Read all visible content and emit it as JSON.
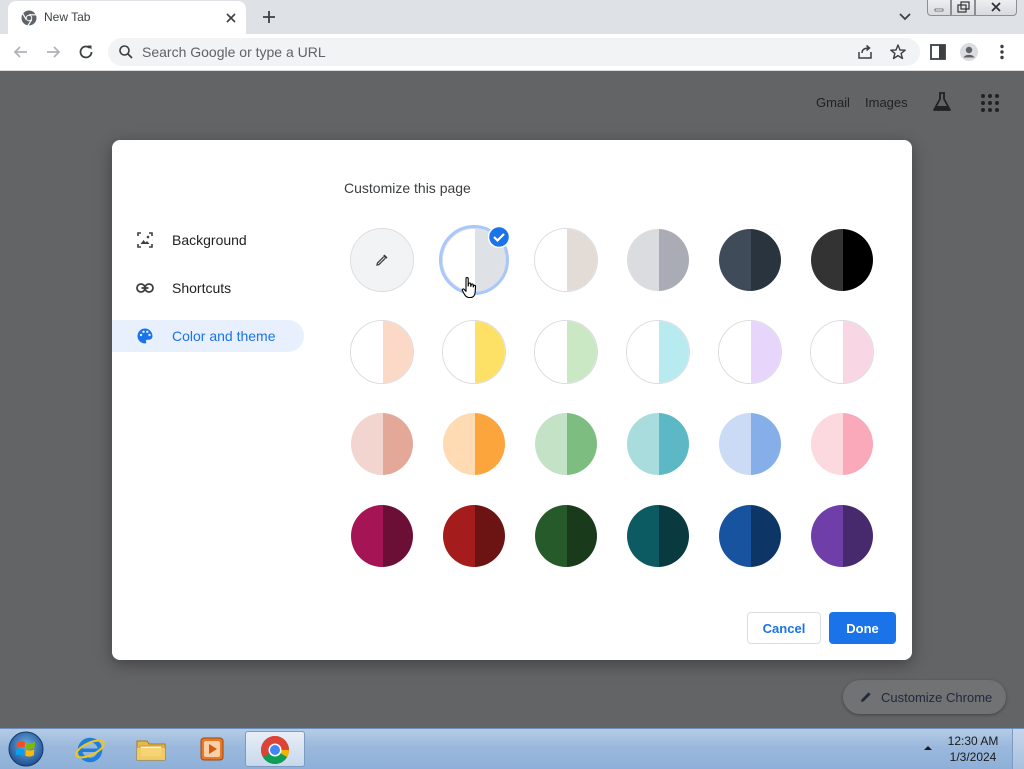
{
  "browser": {
    "tab": {
      "title": "New Tab"
    },
    "omnibox": {
      "placeholder": "Search Google or type a URL"
    }
  },
  "ntp": {
    "links": [
      {
        "label": "Gmail"
      },
      {
        "label": "Images"
      }
    ],
    "customize_chrome_label": "Customize Chrome"
  },
  "dialog": {
    "title": "Customize this page",
    "nav": [
      {
        "label": "Background",
        "icon": "image-icon",
        "active": false
      },
      {
        "label": "Shortcuts",
        "icon": "link-icon",
        "active": false
      },
      {
        "label": "Color and theme",
        "icon": "palette-icon",
        "active": true
      }
    ],
    "swatches": [
      {
        "name": "custom-color",
        "left": "#f1f3f4",
        "right": "#f1f3f4",
        "selected": false,
        "icon": "eyedropper-icon"
      },
      {
        "name": "default",
        "left": "#ffffff",
        "right": "#dee1e6",
        "selected": true
      },
      {
        "name": "warm-grey",
        "left": "#ffffff",
        "right": "#e3dbd6",
        "selected": false
      },
      {
        "name": "cool-grey",
        "left": "#dadce0",
        "right": "#a9acb5",
        "selected": false
      },
      {
        "name": "midnight-blue",
        "left": "#3f4b58",
        "right": "#2a343f",
        "selected": false
      },
      {
        "name": "black",
        "left": "#333333",
        "right": "#000000",
        "selected": false
      },
      {
        "name": "beige-white",
        "left": "#ffffff",
        "right": "#fcd8c6",
        "selected": false
      },
      {
        "name": "yellow-white",
        "left": "#ffffff",
        "right": "#fde166",
        "selected": false
      },
      {
        "name": "green-white",
        "left": "#ffffff",
        "right": "#cbe8c4",
        "selected": false
      },
      {
        "name": "light-teal",
        "left": "#ffffff",
        "right": "#b8ebf0",
        "selected": false
      },
      {
        "name": "light-purple",
        "left": "#ffffff",
        "right": "#e8d5fb",
        "selected": false
      },
      {
        "name": "pink-white",
        "left": "#ffffff",
        "right": "#f9d6e4",
        "selected": false
      },
      {
        "name": "beige",
        "left": "#f2d5ce",
        "right": "#e3a898",
        "selected": false
      },
      {
        "name": "orange",
        "left": "#fedbb3",
        "right": "#fda53d",
        "selected": false
      },
      {
        "name": "light-green",
        "left": "#c4e2c6",
        "right": "#7dbd7f",
        "selected": false
      },
      {
        "name": "light-teal-2",
        "left": "#a9dcdc",
        "right": "#5bb8c4",
        "selected": false
      },
      {
        "name": "light-blue",
        "left": "#cbdbf6",
        "right": "#86aee8",
        "selected": false
      },
      {
        "name": "light-pink",
        "left": "#fcd8df",
        "right": "#f9a9b9",
        "selected": false
      },
      {
        "name": "dark-pink",
        "left": "#a51454",
        "right": "#6c0f37",
        "selected": false
      },
      {
        "name": "dark-red",
        "left": "#a51c1c",
        "right": "#6c1414",
        "selected": false
      },
      {
        "name": "dark-green",
        "left": "#275a2b",
        "right": "#1a3a1c",
        "selected": false
      },
      {
        "name": "dark-teal",
        "left": "#0c5a62",
        "right": "#083a40",
        "selected": false
      },
      {
        "name": "dark-blue",
        "left": "#17539e",
        "right": "#0d3667",
        "selected": false
      },
      {
        "name": "purple",
        "left": "#6f3ea8",
        "right": "#472a6e",
        "selected": false
      }
    ],
    "buttons": {
      "cancel": "Cancel",
      "done": "Done"
    }
  },
  "taskbar": {
    "apps": [
      {
        "name": "Internet Explorer",
        "icon": "internet-explorer-icon",
        "active": false
      },
      {
        "name": "Windows Explorer",
        "icon": "folder-icon",
        "active": false
      },
      {
        "name": "Media Player",
        "icon": "media-player-icon",
        "active": false
      },
      {
        "name": "Google Chrome",
        "icon": "chrome-icon",
        "active": true
      }
    ],
    "clock": {
      "time": "12:30 AM",
      "date": "1/3/2024"
    }
  },
  "colors": {
    "accent": "#1a73e8",
    "selected_ring": "#a8c7fa",
    "active_nav_bg": "#e8f0fe"
  }
}
